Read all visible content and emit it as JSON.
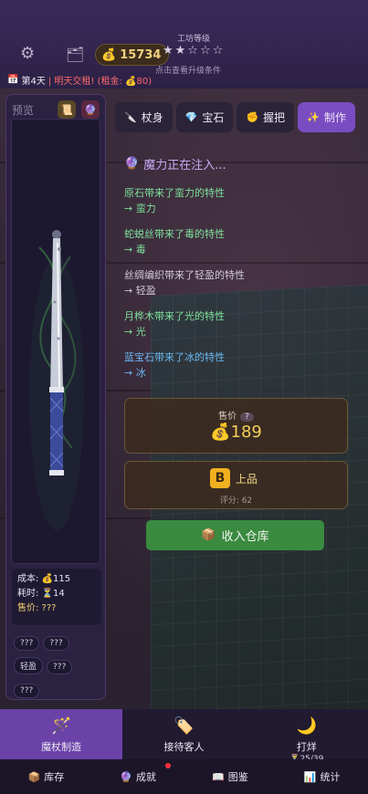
{
  "header": {
    "coins": "15734",
    "workshop_level_label": "工坊等级",
    "stars": "★★☆☆☆",
    "upgrade_hint": "点击查看升级条件",
    "day": "第4天",
    "warning": "| 明天交租! (租金: 💰80)"
  },
  "preview": {
    "title": "预览",
    "cost_label": "成本: 💰115",
    "time_label": "耗时: ⏳14",
    "price_label": "售价: ???",
    "tags": [
      "???",
      "???",
      "轻盈",
      "???",
      "???"
    ]
  },
  "tabs": [
    {
      "icon": "🔪",
      "label": "杖身"
    },
    {
      "icon": "💎",
      "label": "宝石"
    },
    {
      "icon": "✊",
      "label": "握把"
    },
    {
      "icon": "✨",
      "label": "制作"
    }
  ],
  "log": {
    "title": "魔力正在注入...",
    "entries": [
      {
        "line1": "原石带来了蛮力的特性",
        "line2": "→ 蛮力",
        "color": "#7ee09a"
      },
      {
        "line1": "蛇蜕丝带来了毒的特性",
        "line2": "→ 毒",
        "color": "#7ee09a"
      },
      {
        "line1": "丝绸编织带来了轻盈的特性",
        "line2": "→ 轻盈",
        "color": "#cfc8d8"
      },
      {
        "line1": "月桦木带来了光的特性",
        "line2": "→ 光",
        "color": "#7ee09a"
      },
      {
        "line1": "蓝宝石带来了冰的特性",
        "line2": "→ 冰",
        "color": "#6ab8f2"
      }
    ]
  },
  "result": {
    "price_label": "售价",
    "help": "?",
    "price_value": "💰189",
    "grade_letter": "B",
    "grade_name": "上品",
    "score": "评分: 62",
    "store_button": "收入仓库"
  },
  "bottom_nav": {
    "main": [
      {
        "icon": "🪄",
        "label": "魔杖制造",
        "sub": ""
      },
      {
        "icon": "🏷️",
        "label": "接待客人",
        "sub": ""
      },
      {
        "icon": "🌙",
        "label": "打烊",
        "sub": "⏳25/39"
      }
    ],
    "sub": [
      {
        "icon": "📦",
        "label": "库存"
      },
      {
        "icon": "🔮",
        "label": "成就"
      },
      {
        "icon": "📖",
        "label": "图鉴"
      },
      {
        "icon": "📊",
        "label": "统计"
      }
    ]
  }
}
